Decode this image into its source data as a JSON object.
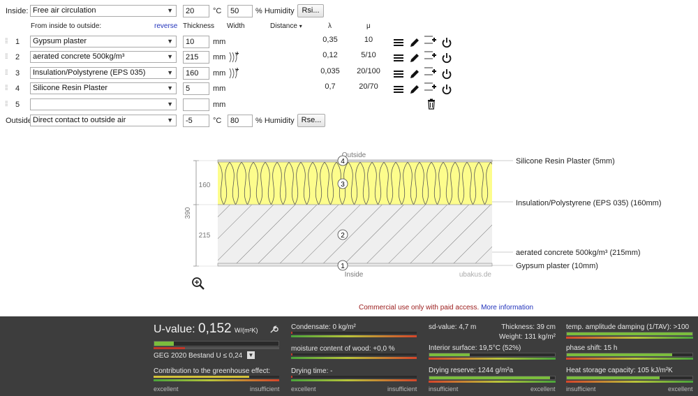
{
  "top": {
    "inside_label": "Inside:",
    "inside_select": "Free air circulation",
    "inside_temp": "20",
    "temp_unit": "°C",
    "inside_humidity": "50",
    "humidity_label": "% Humidity",
    "rsi_button": "Rsi..."
  },
  "columns": {
    "order": "From inside to outside:",
    "reverse": "reverse",
    "thickness": "Thickness",
    "width": "Width",
    "distance": "Distance",
    "distance_arrow": "▾",
    "lambda": "λ",
    "mu": "μ"
  },
  "layers": [
    {
      "num": "1",
      "material": "Gypsum plaster",
      "thickness": "10",
      "unit": "mm",
      "lambda": "0,35",
      "mu": "10"
    },
    {
      "num": "2",
      "material": "aerated concrete 500kg/m³",
      "thickness": "215",
      "unit": "mm",
      "lambda": "0,12",
      "mu": "5/10"
    },
    {
      "num": "3",
      "material": "Insulation/Polystyrene (EPS 035)",
      "thickness": "160",
      "unit": "mm",
      "lambda": "0,035",
      "mu": "20/100"
    },
    {
      "num": "4",
      "material": "Silicone Resin Plaster",
      "thickness": "5",
      "unit": "mm",
      "lambda": "0,7",
      "mu": "20/70"
    },
    {
      "num": "5",
      "material": "",
      "thickness": "",
      "unit": "mm",
      "lambda": "",
      "mu": ""
    }
  ],
  "outside": {
    "label": "Outside",
    "select": "Direct contact to outside air",
    "temp": "-5",
    "temp_unit": "°C",
    "humidity": "80",
    "humidity_label": "% Humidity",
    "rse_button": "Rse..."
  },
  "diagram": {
    "outside_label": "Outside",
    "inside_label": "Inside",
    "watermark": "ubakus.de",
    "dim_total": "390",
    "dim_insulation": "160",
    "dim_concrete": "215",
    "markers": [
      "1",
      "2",
      "3",
      "4"
    ],
    "legend": {
      "silicone": "Silicone Resin Plaster (5mm)",
      "insulation": "Insulation/Polystyrene (EPS 035) (160mm)",
      "concrete": "aerated concrete 500kg/m³ (215mm)",
      "gypsum": "Gypsum plaster (10mm)"
    },
    "colors": {
      "insulation": "#fdfd8c",
      "concrete": "#ececec"
    }
  },
  "notice": {
    "text": "Commercial use only with paid access.",
    "link": "More information"
  },
  "panel": {
    "uvalue_label": "U-value:",
    "uvalue": "0,152",
    "uvalue_unit": "W/(m²K)",
    "geg": "GEG 2020 Bestand U ≤ 0,24",
    "greenhouse": "Contribution to the greenhouse effect:",
    "condensate": "Condensate: 0 kg/m²",
    "moisture": "moisture content of wood: +0,0 %",
    "drying_time": "Drying time: -",
    "sd_value": "sd-value: 4,7 m",
    "thickness": "Thickness: 39 cm",
    "weight": "Weight: 131 kg/m²",
    "interior_surface": "Interior surface: 19,5°C (52%)",
    "drying_reserve": "Drying reserve: 1244 g/m²a",
    "temp_damping": "temp. amplitude damping (1/TAV): >100",
    "phase_shift": "phase shift: 15 h",
    "heat_storage": "Heat storage capacity: 105 kJ/m²K",
    "excellent": "excellent",
    "insufficient": "insufficient",
    "accent": "#7bbd3d"
  }
}
